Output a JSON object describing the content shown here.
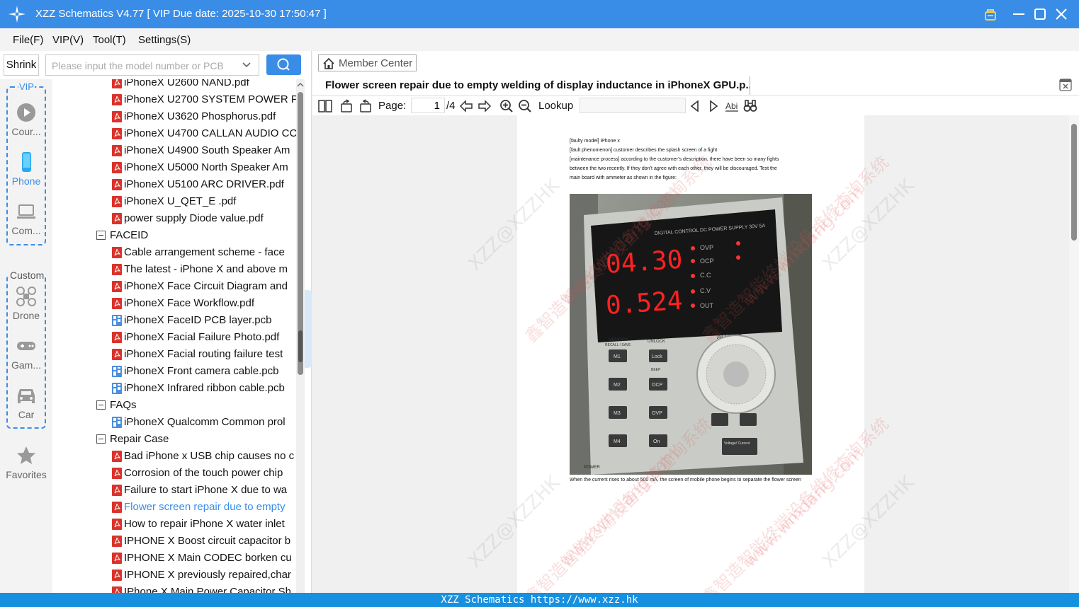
{
  "window": {
    "title": "XZZ Schematics V4.77 [ VIP Due date: 2025-10-30 17:50:47 ]"
  },
  "menu": [
    "File(F)",
    "VIP(V)",
    "Tool(T)",
    "Settings(S)"
  ],
  "left": {
    "shrink_label": "Shrink",
    "search_placeholder": "Please input the model number or PCB",
    "vip_label": "VIP",
    "custom_label": "Custom",
    "categories": {
      "course": "Cour...",
      "phone": "Phone",
      "computer": "Com...",
      "drone": "Drone",
      "game": "Gam...",
      "car": "Car",
      "favorites": "Favorites"
    },
    "tree": [
      {
        "type": "pdf",
        "label": "iPhoneX U2600 NAND.pdf"
      },
      {
        "type": "pdf",
        "label": "iPhoneX U2700 SYSTEM POWER PI"
      },
      {
        "type": "pdf",
        "label": "iPhoneX U3620 Phosphorus.pdf"
      },
      {
        "type": "pdf",
        "label": "iPhoneX U4700 CALLAN AUDIO CC"
      },
      {
        "type": "pdf",
        "label": "iPhoneX U4900 South Speaker Am"
      },
      {
        "type": "pdf",
        "label": "iPhoneX U5000 North Speaker Am"
      },
      {
        "type": "pdf",
        "label": "iPhoneX U5100 ARC DRIVER.pdf"
      },
      {
        "type": "pdf",
        "label": "iPhoneX U_QET_E .pdf"
      },
      {
        "type": "pdf",
        "label": "power supply Diode value.pdf"
      },
      {
        "type": "folder",
        "label": "FACEID"
      },
      {
        "type": "pdf",
        "label": "Cable arrangement scheme - face"
      },
      {
        "type": "pdf",
        "label": "The latest - iPhone X and above m"
      },
      {
        "type": "pdf",
        "label": "iPhoneX Face Circuit Diagram and"
      },
      {
        "type": "pdf",
        "label": "iPhoneX Face Workflow.pdf"
      },
      {
        "type": "pcb",
        "label": "iPhoneX FaceID PCB layer.pcb"
      },
      {
        "type": "pdf",
        "label": "iPhoneX Facial Failure Photo.pdf"
      },
      {
        "type": "pdf",
        "label": "iPhoneX Facial routing failure test"
      },
      {
        "type": "pcb",
        "label": "iPhoneX Front camera cable.pcb"
      },
      {
        "type": "pcb",
        "label": "iPhoneX Infrared ribbon cable.pcb"
      },
      {
        "type": "folder",
        "label": "FAQs"
      },
      {
        "type": "pcb",
        "label": "iPhoneX Qualcomm Common prol"
      },
      {
        "type": "folder",
        "label": "Repair Case"
      },
      {
        "type": "pdf",
        "label": "Bad iPhone x USB chip causes no c"
      },
      {
        "type": "pdf",
        "label": "Corrosion of the touch power chip"
      },
      {
        "type": "pdf",
        "label": "Failure to start iPhone X due to wa"
      },
      {
        "type": "pdf",
        "label": "Flower screen repair due to empty",
        "selected": true
      },
      {
        "type": "pdf",
        "label": "How to repair iPhone X water inlet"
      },
      {
        "type": "pdf",
        "label": "IPHONE X Boost circuit capacitor b"
      },
      {
        "type": "pdf",
        "label": "IPHONE X Main CODEC borken cu"
      },
      {
        "type": "pdf",
        "label": "IPHONE X previously repaired,char"
      },
      {
        "type": "pdf",
        "label": "IPhone X Main Power Capacitor Sh"
      }
    ]
  },
  "right": {
    "member_center": "Member Center",
    "doc_title": "Flower screen repair due to empty welding of display inductance in iPhoneX GPU.p...",
    "page_label": "Page:",
    "page_current": "1",
    "page_total": "/4",
    "lookup_label": "Lookup",
    "lookup_value": "",
    "pdf": {
      "lines": [
        "[faulty model] iPhone x",
        "[fault phenomenon] customer describes the splash screen of a fight",
        "[maintenance process] according to the customer’s description, there have been so many fights",
        "between the two recently. If they don’t agree with each other, they will be discouraged. Test the",
        "main board with ammeter as shown in the figure:"
      ],
      "caption": "When the current rises to about 500 mA, the screen of mobile phone begins to separate the flower screen",
      "display_voltage": "04.30",
      "display_current": "0.524",
      "panel_header": "DIGITAL CONTROL DC POWER SUPPLY 30V 5A",
      "indicators": [
        "OVP",
        "OCP",
        "C.C",
        "C.V",
        "OUT"
      ],
      "memory_label": "MEMORY",
      "recall_label": "RECALL / SAVE",
      "unlock_label": "UNLOCK",
      "adjust_label": "ADJUST",
      "power_label": "POWER",
      "buttons": [
        "M1",
        "M2",
        "M3",
        "M4",
        "Lock",
        "OCP",
        "OVP",
        "On"
      ],
      "beep_label": "BEEP",
      "voltage_current": "Voltage/ Current",
      "watermark_cn": "鑫智造智能终端设备维修查询系统",
      "watermark_url": "www.wmdang.com",
      "watermark_xzz": "XZZ@XZZHK"
    }
  },
  "status": "XZZ Schematics https://www.xzz.hk",
  "colors": {
    "accent": "#3a8de7",
    "pdf_icon": "#d9332b",
    "pcb_icon": "#4a8fe0"
  }
}
